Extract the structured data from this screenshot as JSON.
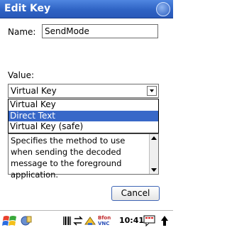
{
  "window": {
    "title": "Edit Key"
  },
  "form": {
    "name_label": "Name:",
    "name_value": "SendMode",
    "value_label": "Value:"
  },
  "combo": {
    "selected": "Virtual Key",
    "options": [
      "Virtual Key",
      "Direct Text",
      "Virtual Key (safe)"
    ],
    "highlighted_option": "Direct Text"
  },
  "description": "Specifies the method to use when sending the decoded message to the foreground application.",
  "buttons": {
    "cancel": "Cancel"
  },
  "taskbar": {
    "time": "10:41",
    "vnc_top": "Bfon",
    "vnc_bottom": "VNC"
  },
  "colors": {
    "titlebar": "#2f63c4",
    "highlight": "#3868c8",
    "cancel_border": "#3f65b5"
  },
  "icons": [
    "ok-button-icon",
    "dropdown-arrow-icon",
    "scroll-up-icon",
    "scroll-down-icon",
    "start-flag-icon",
    "program-icon",
    "barcode-icon",
    "sync-icon",
    "network-icon",
    "vnc-icon",
    "input-panel-icon",
    "arrow-up-icon"
  ]
}
